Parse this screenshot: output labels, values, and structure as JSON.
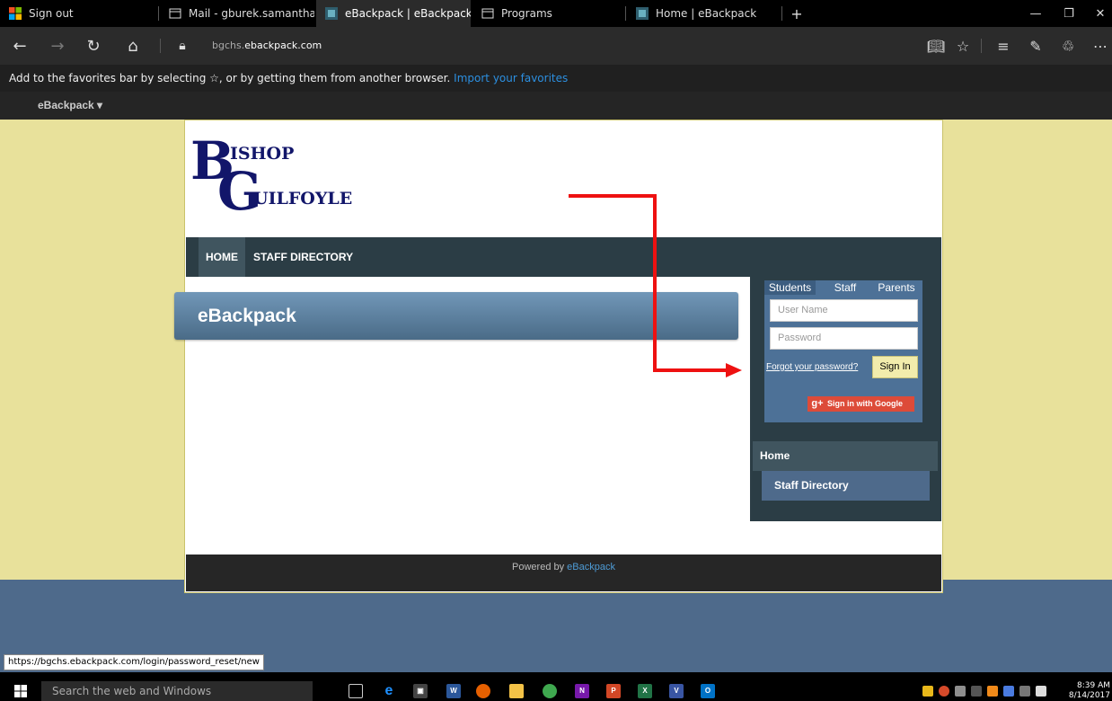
{
  "browser": {
    "tabs": [
      {
        "title": "Sign out",
        "active": false
      },
      {
        "title": "Mail - gburek.samantha@bg",
        "active": false
      },
      {
        "title": "eBackpack | eBackpack",
        "active": true
      },
      {
        "title": "Programs",
        "active": false
      },
      {
        "title": "Home | eBackpack",
        "active": false
      }
    ],
    "new_tab": "+",
    "url_prefix": "bgchs.",
    "url_domain": "ebackpack.com",
    "favorites_hint": "Add to the favorites bar by selecting ☆, or by getting them from another browser.",
    "favorites_link": "Import your favorites",
    "status_url": "https://bgchs.ebackpack.com/login/password_reset/new"
  },
  "site": {
    "menu": "eBackpack ▾",
    "logo": {
      "letter1": "B",
      "word1": "ISHOP",
      "letter2": "G",
      "word2": "UILFOYLE"
    },
    "nav": [
      {
        "label": "HOME",
        "active": true
      },
      {
        "label": "STAFF DIRECTORY",
        "active": false
      }
    ],
    "page_title": "eBackpack",
    "login": {
      "tabs": [
        "Students",
        "Staff",
        "Parents"
      ],
      "username_placeholder": "User Name",
      "password_placeholder": "Password",
      "forgot": "Forgot your password?",
      "signin": "Sign In",
      "google": "Sign in with Google",
      "google_glyph": "g+"
    },
    "side_menu": [
      "Home",
      "Staff Directory"
    ],
    "footer_prefix": "Powered by ",
    "footer_link": "eBackpack"
  },
  "taskbar": {
    "search_placeholder": "Search the web and Windows",
    "time": "8:39 AM",
    "date": "8/14/2017"
  },
  "colors": {
    "page_bg": "#e8e19b",
    "nav_bg": "#2b3d45",
    "accent_blue": "#4d7197",
    "arrow": "#ee1111"
  }
}
